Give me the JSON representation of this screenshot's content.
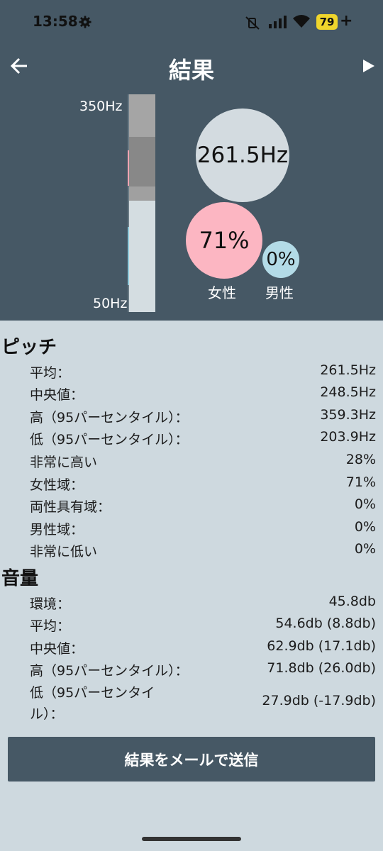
{
  "status_bar": {
    "time": "13:58",
    "battery": "79",
    "charging": "+"
  },
  "appbar": {
    "title": "結果"
  },
  "pitch_graph": {
    "max_label": "350Hz",
    "min_label": "50Hz",
    "average": "261.5Hz",
    "female_percent": "71%",
    "male_percent": "0%",
    "female_label": "女性",
    "male_label": "男性"
  },
  "pitch": {
    "title": "ピッチ",
    "rows": [
      {
        "label": "平均：",
        "value": "261.5Hz"
      },
      {
        "label": "中央値：",
        "value": "248.5Hz"
      },
      {
        "label": "高（95パーセンタイル）：",
        "value": "359.3Hz"
      },
      {
        "label": "低（95パーセンタイル）：",
        "value": "203.9Hz"
      },
      {
        "label": "非常に高い",
        "value": "28%"
      },
      {
        "label": "女性域：",
        "value": "71%"
      },
      {
        "label": "両性具有域：",
        "value": "0%"
      },
      {
        "label": "男性域：",
        "value": "0%"
      },
      {
        "label": "非常に低い",
        "value": "0%"
      }
    ]
  },
  "volume": {
    "title": "音量",
    "rows": [
      {
        "label": "環境：",
        "value": "45.8db"
      },
      {
        "label": "平均：",
        "value": "54.6db (8.8db)"
      },
      {
        "label": "中央値：",
        "value": "62.9db (17.1db)"
      },
      {
        "label": "高（95パーセンタイル）：",
        "value": "71.8db (26.0db)"
      },
      {
        "label": "低（95パーセンタイル）：",
        "label_line1": "低（95パーセンタイ",
        "label_line2": "ル）：",
        "value": "27.9db (-17.9db)"
      }
    ]
  },
  "send_button": "結果をメールで送信"
}
